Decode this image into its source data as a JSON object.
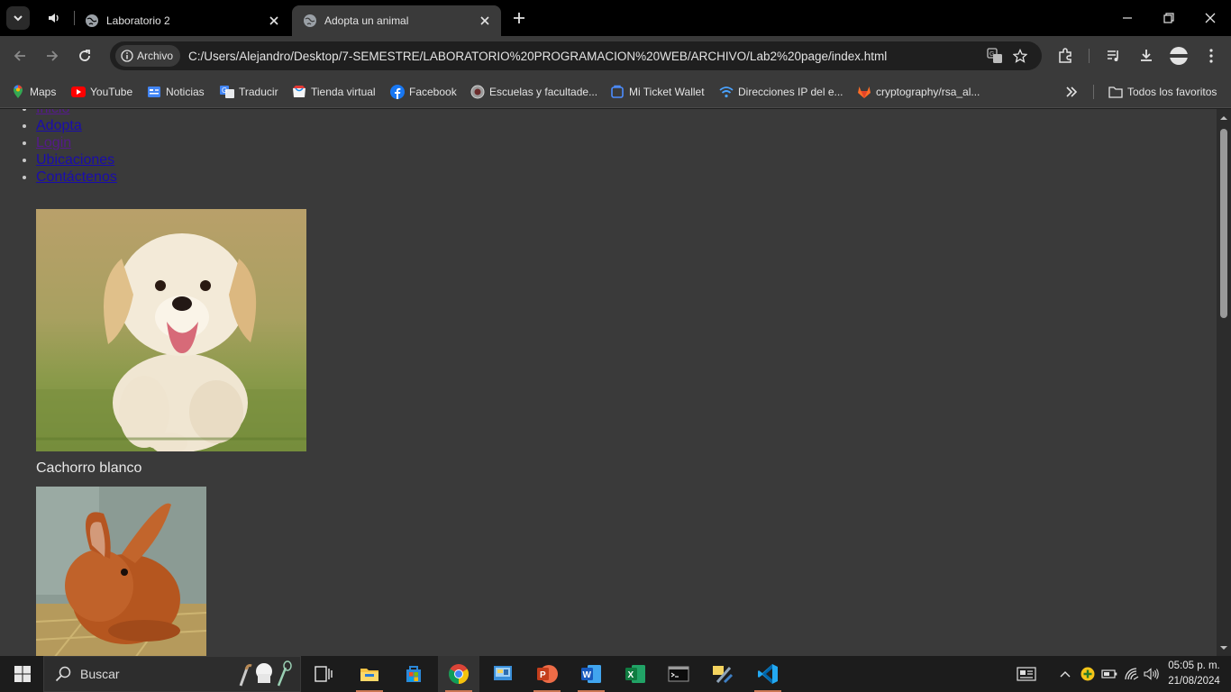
{
  "browser": {
    "tabs": [
      {
        "title": "Laboratorio 2",
        "active": false
      },
      {
        "title": "Adopta un animal",
        "active": true
      }
    ],
    "omnibox": {
      "chip_label": "Archivo",
      "url": "C:/Users/Alejandro/Desktop/7-SEMESTRE/LABORATORIO%20PROGRAMACION%20WEB/ARCHIVO/Lab2%20page/index.html"
    },
    "bookmarks": [
      {
        "label": "Maps",
        "icon": "maps-icon"
      },
      {
        "label": "YouTube",
        "icon": "youtube-icon"
      },
      {
        "label": "Noticias",
        "icon": "news-icon"
      },
      {
        "label": "Traducir",
        "icon": "translate-icon"
      },
      {
        "label": "Tienda virtual",
        "icon": "store-icon"
      },
      {
        "label": "Facebook",
        "icon": "facebook-icon"
      },
      {
        "label": "Escuelas y facultade...",
        "icon": "school-icon"
      },
      {
        "label": "Mi Ticket Wallet",
        "icon": "wallet-icon"
      },
      {
        "label": "Direcciones IP del e...",
        "icon": "wifi-icon"
      },
      {
        "label": "cryptography/rsa_al...",
        "icon": "gitlab-icon"
      }
    ],
    "all_bookmarks_label": "Todos los favoritos"
  },
  "page": {
    "nav": [
      {
        "label": "Inicio",
        "visited": true
      },
      {
        "label": "Adopta",
        "visited": false
      },
      {
        "label": "Login",
        "visited": true
      },
      {
        "label": "Ubicaciones",
        "visited": false
      },
      {
        "label": "Contáctenos",
        "visited": false
      }
    ],
    "animals": [
      {
        "caption": "Cachorro blanco",
        "image": "puppy-photo"
      },
      {
        "caption": "",
        "image": "rabbit-photo"
      }
    ]
  },
  "taskbar": {
    "search_label": "Buscar",
    "time": "05:05 p. m.",
    "date": "21/08/2024"
  },
  "colors": {
    "link": "#1a0dab",
    "visited_link": "#551a8b",
    "page_bg": "#3a3a3a",
    "taskbar_bg": "#1c1c1c"
  }
}
